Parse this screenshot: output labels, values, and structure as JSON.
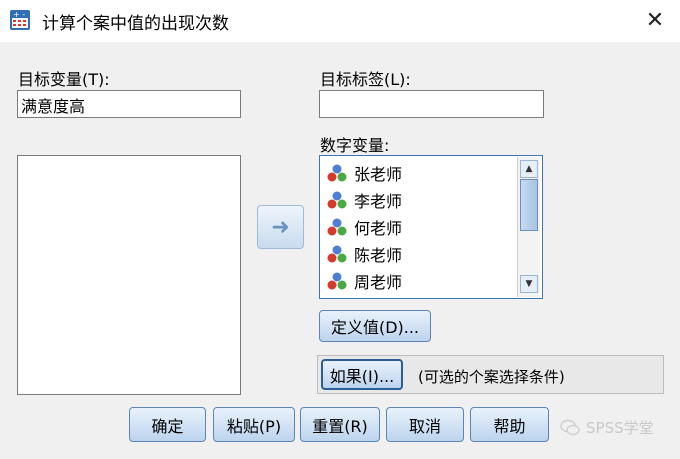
{
  "window": {
    "title": "计算个案中值的出现次数",
    "close_label": "✕"
  },
  "target_variable": {
    "label": "目标变量(T):",
    "value": "满意度高"
  },
  "target_label": {
    "label": "目标标签(L):",
    "value": ""
  },
  "numeric_variables": {
    "label": "数字变量:",
    "items": [
      "张老师",
      "李老师",
      "何老师",
      "陈老师",
      "周老师"
    ]
  },
  "buttons": {
    "move_arrow": "➜",
    "define_values": "定义值(D)...",
    "if": "如果(I)...",
    "if_note": "(可选的个案选择条件)",
    "ok": "确定",
    "paste": "粘贴(P)",
    "reset": "重置(R)",
    "cancel": "取消",
    "help": "帮助"
  },
  "watermark": "SPSS学堂",
  "icon_names": [
    "calculator-icon",
    "variable-scale-icon",
    "wechat-icon"
  ]
}
